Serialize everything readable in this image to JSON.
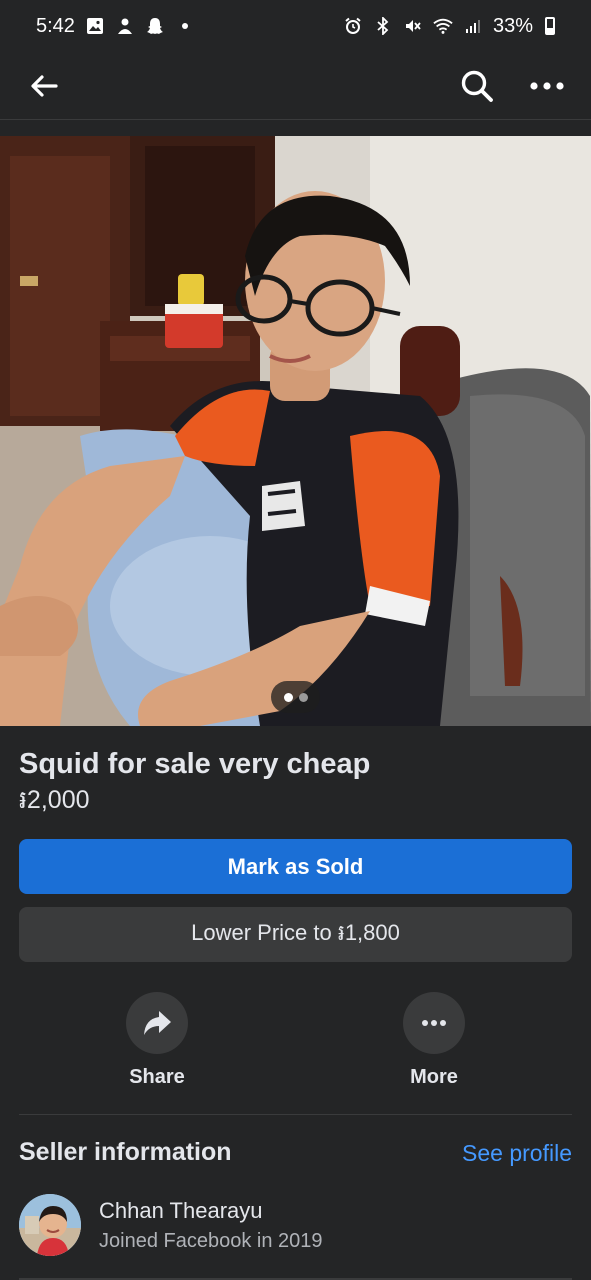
{
  "status_bar": {
    "time": "5:42",
    "battery": "33%",
    "left_icons": [
      "gallery-icon",
      "person-icon",
      "snapchat-icon",
      "dot-icon"
    ],
    "right_icons": [
      "alarm-icon",
      "bluetooth-icon",
      "mute-icon",
      "wifi-icon",
      "signal-icon",
      "battery-icon"
    ]
  },
  "nav": {
    "back_icon": "back-arrow-icon",
    "search_icon": "search-icon",
    "more_icon": "more-horizontal-icon"
  },
  "listing": {
    "photo_pager": {
      "total": 2,
      "current": 1
    },
    "title": "Squid for sale very cheap",
    "price": "៛2,000"
  },
  "buttons": {
    "mark_sold": "Mark as Sold",
    "lower_price": "Lower Price to ៛1,800"
  },
  "actions": [
    {
      "label": "Share",
      "icon": "share-icon"
    },
    {
      "label": "More",
      "icon": "more-horizontal-icon"
    }
  ],
  "seller": {
    "heading": "Seller information",
    "see_profile": "See profile",
    "name": "Chhan Thearayu",
    "joined": "Joined Facebook in 2019"
  },
  "colors": {
    "background": "#242526",
    "primary_button": "#1b6fd6",
    "secondary_button": "#3a3b3c",
    "link": "#4599ff"
  }
}
